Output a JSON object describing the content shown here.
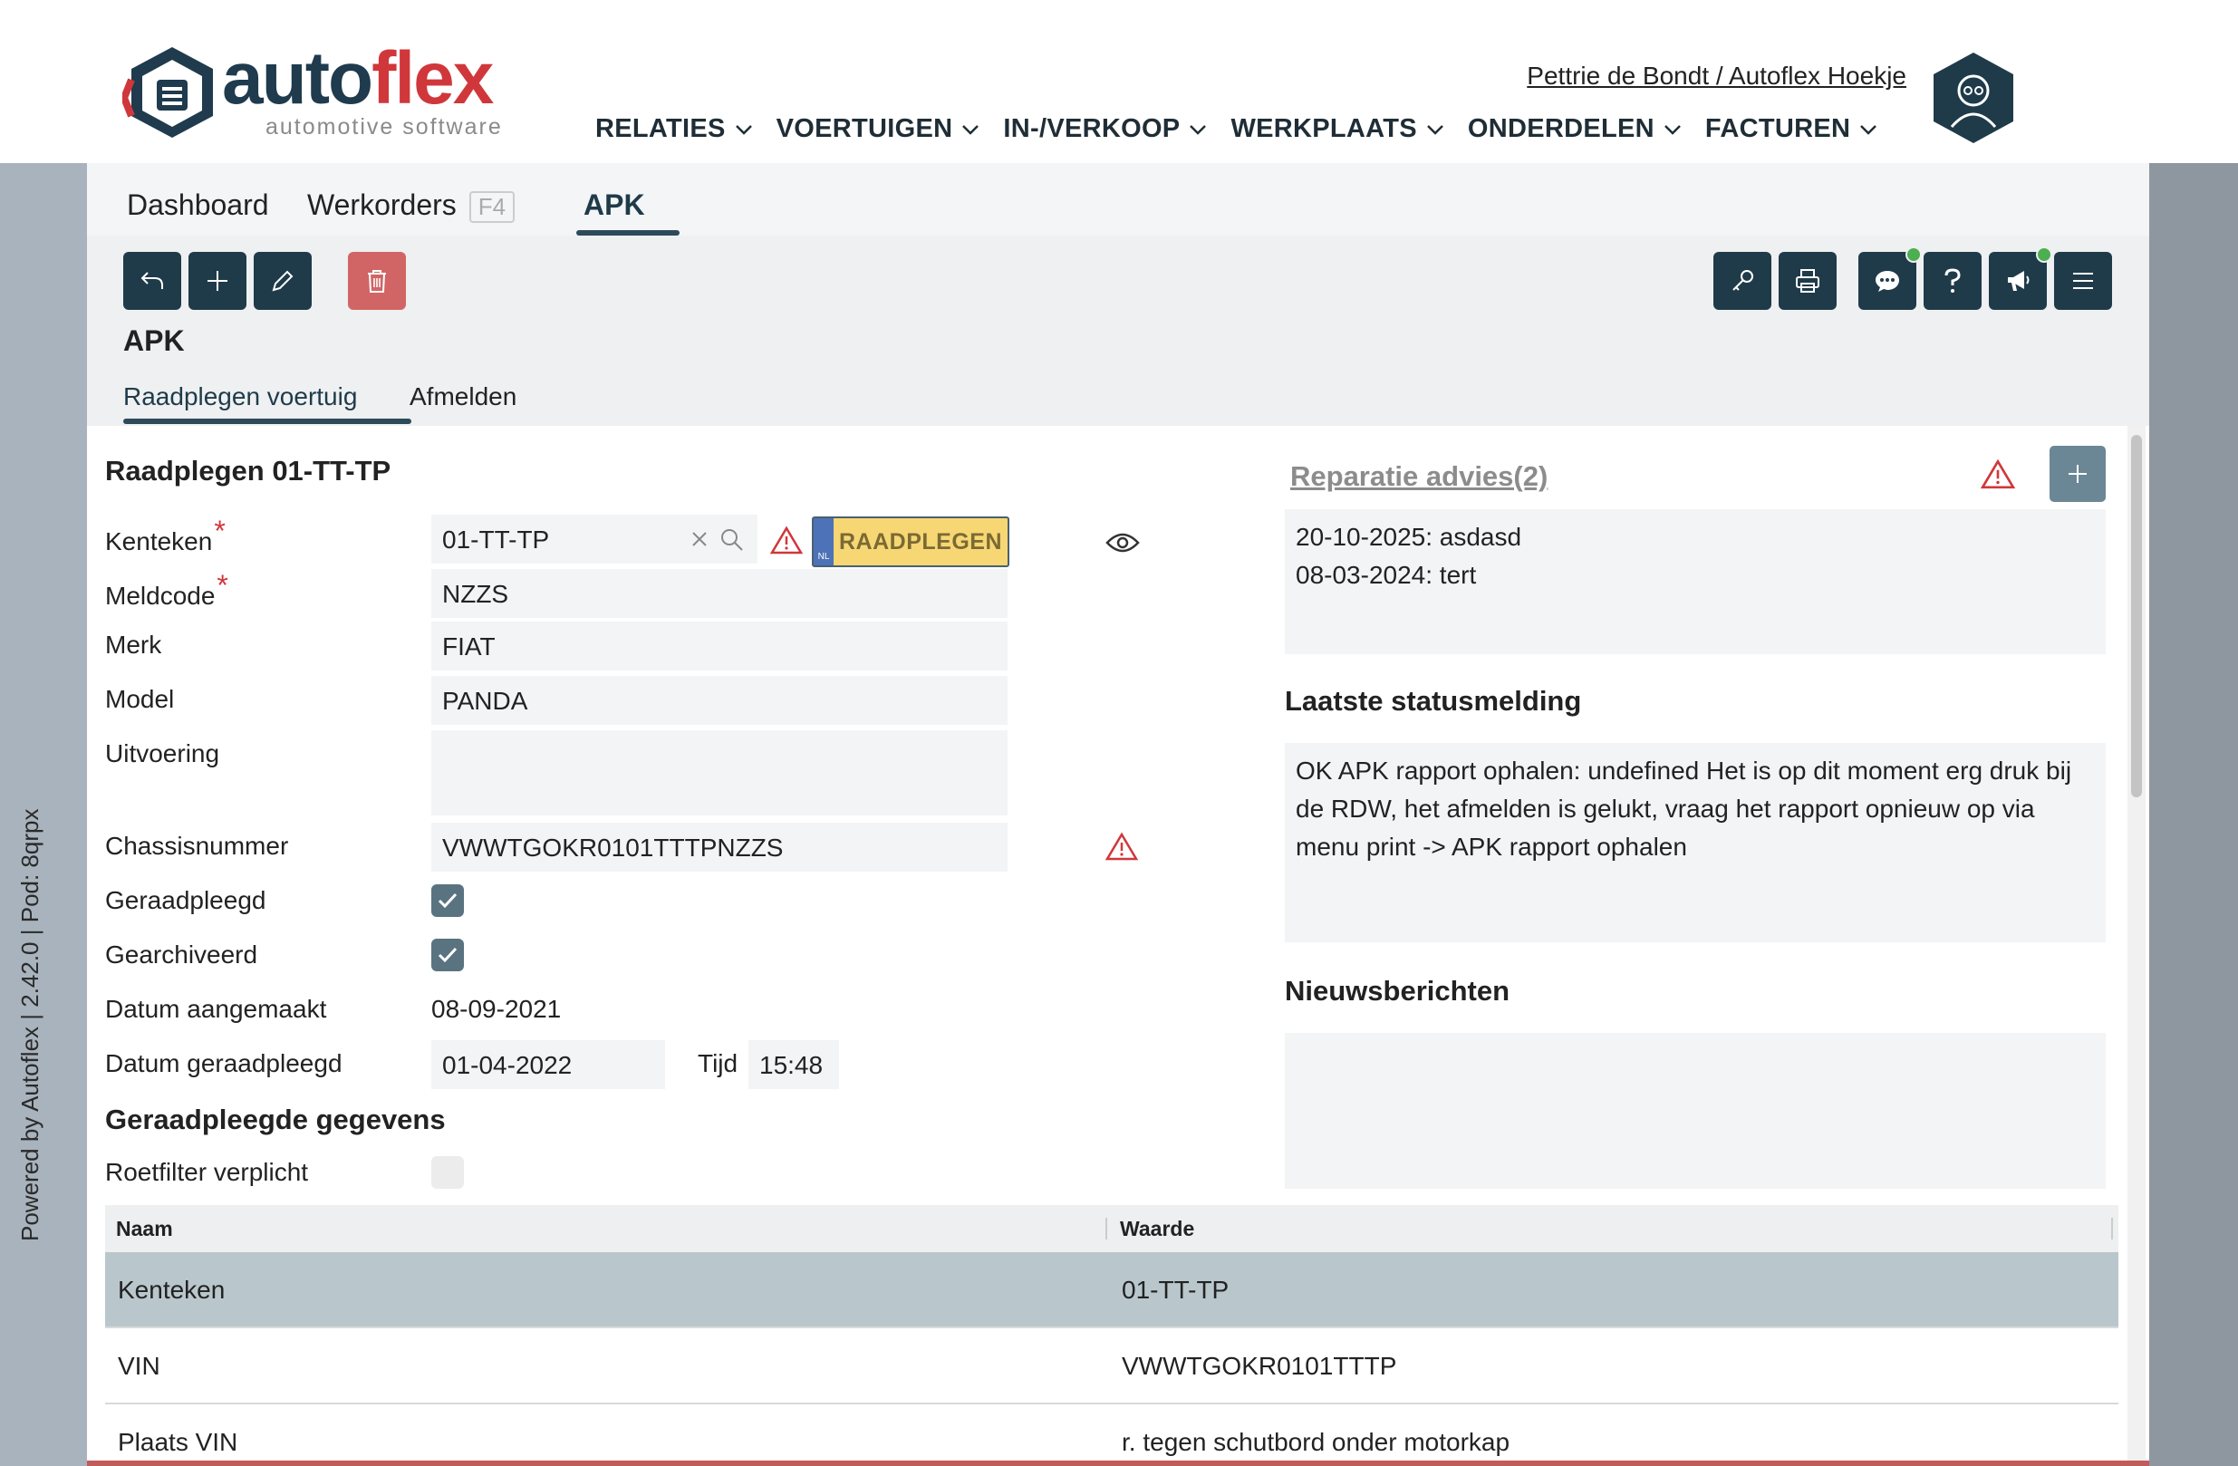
{
  "brand": {
    "name_part1": "auto",
    "name_part2": "flex",
    "tagline": "automotive software"
  },
  "user": {
    "link_text": "Pettrie de Bondt / Autoflex Hoekje"
  },
  "main_nav": [
    {
      "label": "RELATIES"
    },
    {
      "label": "VOERTUIGEN"
    },
    {
      "label": "IN-/VERKOOP"
    },
    {
      "label": "WERKPLAATS"
    },
    {
      "label": "ONDERDELEN"
    },
    {
      "label": "FACTUREN"
    }
  ],
  "side_text": "Powered by Autoflex | 2.42.0 | Pod: 8qrpx",
  "tabs": {
    "dashboard": "Dashboard",
    "werkorders": "Werkorders",
    "werkorders_key": "F4",
    "apk": "APK"
  },
  "page_title": "APK",
  "subtabs": {
    "raadplegen": "Raadplegen voertuig",
    "afmelden": "Afmelden"
  },
  "form": {
    "title": "Raadplegen 01-TT-TP",
    "required_mark": "*",
    "kenteken_label": "Kenteken",
    "kenteken_value": "01-TT-TP",
    "raadplegen_button": "RAADPLEGEN",
    "nl_badge": "NL",
    "meldcode_label": "Meldcode",
    "meldcode_value": "NZZS",
    "merk_label": "Merk",
    "merk_value": "FIAT",
    "model_label": "Model",
    "model_value": "PANDA",
    "uitvoering_label": "Uitvoering",
    "uitvoering_value": "",
    "chassis_label": "Chassisnummer",
    "chassis_value": "VWWTGOKR0101TTTPNZZS",
    "geraadpleegd_label": "Geraadpleegd",
    "geraadpleegd_checked": true,
    "gearchiveerd_label": "Gearchiveerd",
    "gearchiveerd_checked": true,
    "datum_aangemaakt_label": "Datum aangemaakt",
    "datum_aangemaakt_value": "08-09-2021",
    "datum_geraadpleegd_label": "Datum geraadpleegd",
    "datum_geraadpleegd_value": "01-04-2022",
    "tijd_label": "Tijd",
    "tijd_value": "15:48"
  },
  "geraadpleegde": {
    "title": "Geraadpleegde gegevens",
    "roetfilter_label": "Roetfilter verplicht",
    "roetfilter_checked": false
  },
  "table": {
    "headers": [
      "Naam",
      "Waarde"
    ],
    "rows": [
      {
        "naam": "Kenteken",
        "waarde": "01-TT-TP"
      },
      {
        "naam": "VIN",
        "waarde": "VWWTGOKR0101TTTP"
      },
      {
        "naam": "Plaats VIN",
        "waarde": "r. tegen schutbord onder motorkap"
      }
    ]
  },
  "reparatie": {
    "title": "Reparatie advies(2)",
    "items": [
      "20-10-2025: asdasd",
      "08-03-2024: tert"
    ]
  },
  "status": {
    "title": "Laatste statusmelding",
    "text": "OK APK rapport ophalen: undefined Het is op dit moment erg druk bij de RDW, het afmelden is gelukt, vraag het rapport opnieuw op via menu print -> APK rapport ophalen"
  },
  "nieuws": {
    "title": "Nieuwsberichten"
  },
  "colors": {
    "dark": "#1f3b4a",
    "brand_red": "#d0373b",
    "danger": "#d16565",
    "plate_yellow": "#f7d774",
    "selected_row": "#b9c7cd"
  }
}
